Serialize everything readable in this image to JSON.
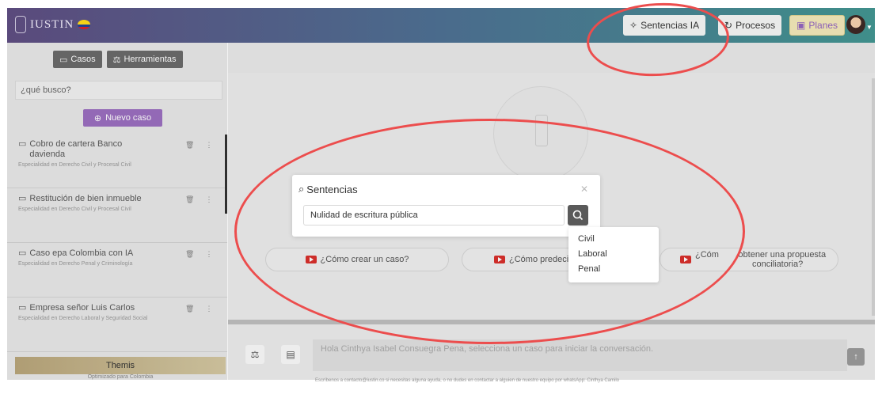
{
  "topbar": {
    "logo_text": "IUSTIN",
    "btn_sentencias": "Sentencias IA",
    "btn_procesos": "Procesos",
    "btn_planes": "Planes"
  },
  "sidebar": {
    "tab_casos": "Casos",
    "tab_herramientas": "Herramientas",
    "search_placeholder": "¿qué busco?",
    "btn_nuevo": "Nuevo caso",
    "cases": [
      {
        "title": "Cobro de cartera Banco davienda",
        "sub": "Especialidad en Derecho Civil y Procesal Civil"
      },
      {
        "title": "Restitución de bien inmueble",
        "sub": "Especialidad en Derecho Civil y Procesal Civil"
      },
      {
        "title": "Caso epa Colombia con IA",
        "sub": "Especialidad en Derecho Penal y Criminología"
      },
      {
        "title": "Empresa señor Luis Carlos",
        "sub": "Especialidad en Derecho Laboral y Seguridad Social"
      }
    ],
    "themis_label": "Themis",
    "themis_sub": "Optimizado para Colombia"
  },
  "main": {
    "pill_1": "¿Cómo crear un caso?",
    "pill_2": "¿Cómo predeci",
    "pill_3_line1": "¿Cóm",
    "pill_3_line2": "obtener una propuesta",
    "pill_3_line3": "conciliatoria?",
    "chat_placeholder": "Hola Cinthya Isabel Consuegra Pena, selecciona un caso para iniciar la conversación.",
    "footer_note": "Escríbenos a contacto@iustin.co si necesitas alguna ayuda, o no dudes en contactar a alguien de nuestro equipo por whatsApp: Cinthya Camilo"
  },
  "modal": {
    "title": "Sentencias",
    "input_value": "Nulidad de escritura pública",
    "options": [
      "Civil",
      "Laboral",
      "Penal"
    ]
  },
  "colors": {
    "accent_purple": "#9b6fc0",
    "annotation_red": "#ec4d4d",
    "planes_bg": "#e7ddb0"
  }
}
